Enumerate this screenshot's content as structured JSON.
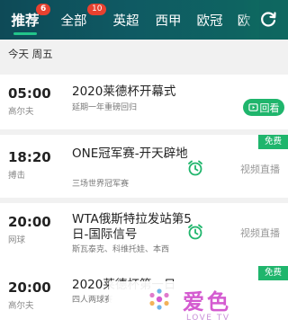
{
  "tabs": [
    {
      "label": "推荐",
      "badge": "6",
      "active": true
    },
    {
      "label": "全部",
      "badge": "10"
    },
    {
      "label": "英超"
    },
    {
      "label": "西甲"
    },
    {
      "label": "欧冠"
    },
    {
      "label": "欧"
    }
  ],
  "date_header": "今天 周五",
  "matches": [
    {
      "time": "05:00",
      "sport": "高尔夫",
      "title": "2020莱德杯开幕式",
      "subtitle": "延期一年重磅回归",
      "action": "回看"
    },
    {
      "time": "18:20",
      "sport": "搏击",
      "title": "ONE冠军赛-开天辟地",
      "subtitle": "三场世界冠军赛",
      "free": "免费",
      "action": "视频直播"
    },
    {
      "time": "20:00",
      "sport": "网球",
      "title": "WTA俄斯特拉发站第5日-国际信号",
      "subtitle": "斯瓦泰克、科维托娃、本西",
      "action": "视频直播"
    },
    {
      "time": "20:00",
      "sport": "高尔夫",
      "title": "2020莱德杯第一日",
      "subtitle": "四人两球赛",
      "free": "免费"
    }
  ],
  "watermark": {
    "text": "爱色",
    "sub": "LOVE TV"
  },
  "colors": {
    "header_bg": "#0e5a62",
    "accent": "#1fb56c",
    "badge": "#e8412f"
  }
}
